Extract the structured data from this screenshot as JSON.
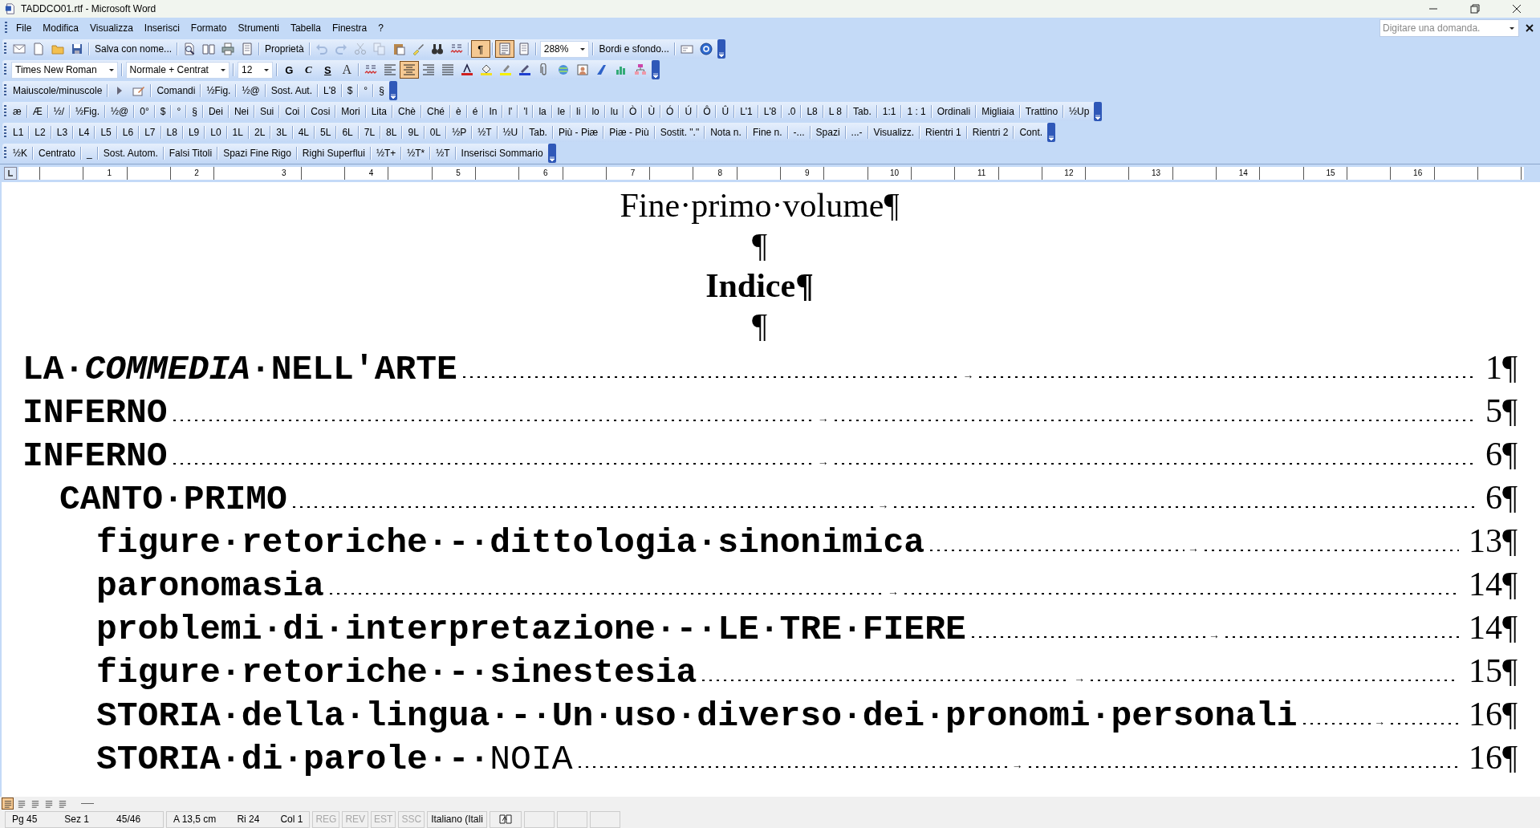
{
  "window": {
    "title": "TADDCO01.rtf - Microsoft Word"
  },
  "menu": [
    "File",
    "Modifica",
    "Visualizza",
    "Inserisci",
    "Formato",
    "Strumenti",
    "Tabella",
    "Finestra",
    "?"
  ],
  "help_box": {
    "placeholder": "Digitare una domanda."
  },
  "toolbars": [
    {
      "items": [
        {
          "kind": "icon",
          "on": false,
          "disabled": false
        },
        {
          "kind": "icon",
          "on": false,
          "disabled": false
        },
        {
          "kind": "icon",
          "on": false,
          "disabled": false
        },
        {
          "kind": "icon",
          "on": false,
          "disabled": false
        },
        {
          "kind": "button",
          "label": "Salva con nome..."
        },
        {
          "kind": "icon",
          "on": false,
          "disabled": false
        },
        {
          "kind": "icon",
          "on": false,
          "disabled": false
        },
        {
          "kind": "icon",
          "on": false,
          "disabled": false
        },
        {
          "kind": "icon",
          "on": false,
          "disabled": false
        },
        {
          "kind": "button",
          "label": "Proprietà"
        },
        {
          "kind": "icon",
          "on": false,
          "disabled": true
        },
        {
          "kind": "icon",
          "on": false,
          "disabled": true
        },
        {
          "kind": "icon",
          "on": false,
          "disabled": true
        },
        {
          "kind": "icon",
          "on": false,
          "disabled": true
        },
        {
          "kind": "icon",
          "on": false,
          "disabled": false
        },
        {
          "kind": "icon",
          "on": false,
          "disabled": false
        },
        {
          "kind": "icon",
          "on": false,
          "disabled": false
        },
        {
          "kind": "icon",
          "on": false,
          "disabled": false
        },
        {
          "kind": "glyph",
          "label": "¶",
          "on": true
        },
        {
          "kind": "icon",
          "on": true,
          "disabled": false
        },
        {
          "kind": "icon",
          "on": false,
          "disabled": false
        },
        {
          "kind": "combo",
          "value": "288%"
        },
        {
          "kind": "button",
          "label": "Bordi e sfondo..."
        },
        {
          "kind": "icon",
          "on": false,
          "disabled": false
        },
        {
          "kind": "icon",
          "on": false,
          "disabled": false
        }
      ]
    },
    {
      "items": [
        {
          "kind": "combo",
          "value": "Times New Roman"
        },
        {
          "kind": "combo",
          "value": "Normale + Centrat"
        },
        {
          "kind": "combo",
          "value": "12"
        },
        {
          "kind": "glyph",
          "label": "G",
          "on": false
        },
        {
          "kind": "glyph",
          "label": "C",
          "on": false
        },
        {
          "kind": "glyph",
          "label": "S",
          "on": false
        },
        {
          "kind": "glyph",
          "label": "A",
          "on": false
        },
        {
          "kind": "icon",
          "on": false,
          "disabled": false
        },
        {
          "kind": "icon",
          "on": false,
          "disabled": false
        },
        {
          "kind": "icon",
          "on": true,
          "disabled": false
        },
        {
          "kind": "icon",
          "on": false,
          "disabled": false
        },
        {
          "kind": "icon",
          "on": false,
          "disabled": false
        },
        {
          "kind": "icon",
          "on": false,
          "disabled": false
        },
        {
          "kind": "icon",
          "on": false,
          "disabled": false
        },
        {
          "kind": "icon",
          "on": false,
          "disabled": false
        },
        {
          "kind": "icon",
          "on": false,
          "disabled": false
        },
        {
          "kind": "icon",
          "on": false,
          "disabled": false
        },
        {
          "kind": "icon",
          "on": false,
          "disabled": false
        },
        {
          "kind": "icon",
          "on": false,
          "disabled": false
        },
        {
          "kind": "icon",
          "on": false,
          "disabled": false
        },
        {
          "kind": "icon",
          "on": false,
          "disabled": false
        },
        {
          "kind": "icon",
          "on": false,
          "disabled": false
        }
      ]
    },
    {
      "items": [
        {
          "kind": "button",
          "label": "Maiuscole/minuscole"
        },
        {
          "kind": "icon",
          "on": false,
          "disabled": false
        },
        {
          "kind": "icon",
          "on": false,
          "disabled": false
        },
        {
          "kind": "button",
          "label": "Comandi"
        },
        {
          "kind": "button",
          "label": "½Fig."
        },
        {
          "kind": "button",
          "label": "½@"
        },
        {
          "kind": "button",
          "label": "Sost. Aut."
        },
        {
          "kind": "button",
          "label": "L'8"
        },
        {
          "kind": "button",
          "label": "$"
        },
        {
          "kind": "button",
          "label": "°"
        },
        {
          "kind": "button",
          "label": "§"
        }
      ]
    },
    {
      "items": [
        {
          "kind": "button",
          "label": "æ"
        },
        {
          "kind": "button",
          "label": "Æ"
        },
        {
          "kind": "button",
          "label": "½/"
        },
        {
          "kind": "button",
          "label": "½Fig."
        },
        {
          "kind": "button",
          "label": "½@"
        },
        {
          "kind": "button",
          "label": "0°"
        },
        {
          "kind": "button",
          "label": "$"
        },
        {
          "kind": "button",
          "label": "°"
        },
        {
          "kind": "button",
          "label": "§"
        },
        {
          "kind": "button",
          "label": "Dei"
        },
        {
          "kind": "button",
          "label": "Nei"
        },
        {
          "kind": "button",
          "label": "Sui"
        },
        {
          "kind": "button",
          "label": "Coi"
        },
        {
          "kind": "button",
          "label": "Cosi"
        },
        {
          "kind": "button",
          "label": "Mori"
        },
        {
          "kind": "button",
          "label": "Lita"
        },
        {
          "kind": "button",
          "label": "Chè"
        },
        {
          "kind": "button",
          "label": "Ché"
        },
        {
          "kind": "button",
          "label": "è"
        },
        {
          "kind": "button",
          "label": "é"
        },
        {
          "kind": "button",
          "label": "In"
        },
        {
          "kind": "button",
          "label": "l'"
        },
        {
          "kind": "button",
          "label": "'l"
        },
        {
          "kind": "button",
          "label": "la"
        },
        {
          "kind": "button",
          "label": "le"
        },
        {
          "kind": "button",
          "label": "li"
        },
        {
          "kind": "button",
          "label": "lo"
        },
        {
          "kind": "button",
          "label": "lu"
        },
        {
          "kind": "button",
          "label": "Ò"
        },
        {
          "kind": "button",
          "label": "Ù"
        },
        {
          "kind": "button",
          "label": "Ó"
        },
        {
          "kind": "button",
          "label": "Ú"
        },
        {
          "kind": "button",
          "label": "Ô"
        },
        {
          "kind": "button",
          "label": "Û"
        },
        {
          "kind": "button",
          "label": "L'1"
        },
        {
          "kind": "button",
          "label": "L'8"
        },
        {
          "kind": "button",
          "label": ".0"
        },
        {
          "kind": "button",
          "label": "L8"
        },
        {
          "kind": "button",
          "label": "L 8"
        },
        {
          "kind": "button",
          "label": "Tab."
        },
        {
          "kind": "button",
          "label": "1:1"
        },
        {
          "kind": "button",
          "label": "1 : 1"
        },
        {
          "kind": "button",
          "label": "Ordinali"
        },
        {
          "kind": "button",
          "label": "Migliaia"
        },
        {
          "kind": "button",
          "label": "Trattino"
        },
        {
          "kind": "button",
          "label": "½Up"
        }
      ]
    },
    {
      "items": [
        {
          "kind": "button",
          "label": "L1"
        },
        {
          "kind": "button",
          "label": "L2"
        },
        {
          "kind": "button",
          "label": "L3"
        },
        {
          "kind": "button",
          "label": "L4"
        },
        {
          "kind": "button",
          "label": "L5"
        },
        {
          "kind": "button",
          "label": "L6"
        },
        {
          "kind": "button",
          "label": "L7"
        },
        {
          "kind": "button",
          "label": "L8"
        },
        {
          "kind": "button",
          "label": "L9"
        },
        {
          "kind": "button",
          "label": "L0"
        },
        {
          "kind": "button",
          "label": "1L"
        },
        {
          "kind": "button",
          "label": "2L"
        },
        {
          "kind": "button",
          "label": "3L"
        },
        {
          "kind": "button",
          "label": "4L"
        },
        {
          "kind": "button",
          "label": "5L"
        },
        {
          "kind": "button",
          "label": "6L"
        },
        {
          "kind": "button",
          "label": "7L"
        },
        {
          "kind": "button",
          "label": "8L"
        },
        {
          "kind": "button",
          "label": "9L"
        },
        {
          "kind": "button",
          "label": "0L"
        },
        {
          "kind": "button",
          "label": "½P"
        },
        {
          "kind": "button",
          "label": "½T"
        },
        {
          "kind": "button",
          "label": "½U"
        },
        {
          "kind": "button",
          "label": "Tab."
        },
        {
          "kind": "button",
          "label": "Più - Piæ"
        },
        {
          "kind": "button",
          "label": "Piæ - Più"
        },
        {
          "kind": "button",
          "label": "Sostit. \".\""
        },
        {
          "kind": "button",
          "label": "Nota n."
        },
        {
          "kind": "button",
          "label": "Fine n."
        },
        {
          "kind": "button",
          "label": "-..."
        },
        {
          "kind": "button",
          "label": "Spazi"
        },
        {
          "kind": "button",
          "label": "...-"
        },
        {
          "kind": "button",
          "label": "Visualizz."
        },
        {
          "kind": "button",
          "label": "Rientri 1"
        },
        {
          "kind": "button",
          "label": "Rientri 2"
        },
        {
          "kind": "button",
          "label": "Cont."
        }
      ]
    },
    {
      "items": [
        {
          "kind": "button",
          "label": "½K"
        },
        {
          "kind": "button",
          "label": "Centrato"
        },
        {
          "kind": "button",
          "label": "_"
        },
        {
          "kind": "button",
          "label": "Sost. Autom."
        },
        {
          "kind": "button",
          "label": "Falsi Titoli"
        },
        {
          "kind": "button",
          "label": "Spazi Fine Rigo"
        },
        {
          "kind": "button",
          "label": "Righi Superflui"
        },
        {
          "kind": "button",
          "label": "½T+"
        },
        {
          "kind": "button",
          "label": "½T*"
        },
        {
          "kind": "button",
          "label": "½T"
        },
        {
          "kind": "button",
          "label": "Inserisci Sommario"
        }
      ]
    }
  ],
  "ruler": {
    "numbers": [
      "1",
      "2",
      "3",
      "4",
      "5",
      "6",
      "7",
      "8",
      "9",
      "10",
      "11",
      "12",
      "13",
      "14",
      "15",
      "16"
    ]
  },
  "document": {
    "headings": [
      {
        "text": "Fine·primo·volume¶",
        "bold": false
      },
      {
        "text": "¶",
        "bold": false
      },
      {
        "text": "Indice¶",
        "bold": true
      },
      {
        "text": "¶",
        "bold": false
      }
    ],
    "toc": [
      {
        "title": "LA·*COMMEDIA*·NELL'ARTE",
        "bold": true,
        "tab_mark": "→",
        "page": "1¶"
      },
      {
        "title": "INFERNO",
        "bold": true,
        "tab_mark": "→",
        "page": "5¶"
      },
      {
        "title": "INFERNO",
        "bold": true,
        "tab_mark": "→",
        "page": "6¶",
        "children": [
          {
            "title": "CANTO·PRIMO",
            "bold": true,
            "tab_mark": "→",
            "page": "6¶",
            "children": [
              {
                "title": "figure·retoriche·-·dittologia·sinonimica",
                "bold": true,
                "tab_mark": "→",
                "page": "13¶"
              },
              {
                "title": "paronomasia",
                "bold": true,
                "tab_mark": "→",
                "page": "14¶"
              },
              {
                "title": "problemi·di·interpretazione·-·LE·TRE·FIERE",
                "bold": true,
                "tab_mark": "→",
                "page": "14¶"
              },
              {
                "title": "figure·retoriche·-·sinestesia",
                "bold": true,
                "tab_mark": "→",
                "page": "15¶"
              },
              {
                "title": "STORIA·della·lingua·-·Un·uso·diverso·dei·pronomi·personali",
                "bold": true,
                "tab_mark": "→",
                "page": "16¶"
              },
              {
                "title": "**STORIA·di·parole·-·**NOIA",
                "bold": false,
                "tab_mark": "→",
                "page": "16¶"
              }
            ]
          }
        ]
      }
    ]
  },
  "views": [
    {
      "selected": true
    },
    {
      "selected": false
    },
    {
      "selected": false
    },
    {
      "selected": false
    },
    {
      "selected": false
    }
  ],
  "status_bar": {
    "position": [
      "Pg 45",
      "Sez 1",
      "45/46"
    ],
    "cursor": [
      "A 13,5 cm",
      "Ri 24",
      "Col 1"
    ],
    "modes": [
      {
        "label": "REG",
        "disabled": true
      },
      {
        "label": "REV",
        "disabled": true
      },
      {
        "label": "EST",
        "disabled": true
      },
      {
        "label": "SSC",
        "disabled": true
      }
    ],
    "language": "Italiano (Itali"
  }
}
